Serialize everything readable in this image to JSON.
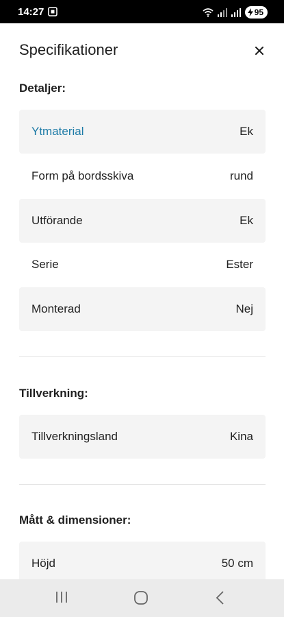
{
  "status_bar": {
    "time": "14:27",
    "battery": "95"
  },
  "header": {
    "title": "Specifikationer"
  },
  "sections": [
    {
      "title": "Detaljer:",
      "rows": [
        {
          "label": "Ytmaterial",
          "value": "Ek"
        },
        {
          "label": "Form på bordsskiva",
          "value": "rund"
        },
        {
          "label": "Utförande",
          "value": "Ek"
        },
        {
          "label": "Serie",
          "value": "Ester"
        },
        {
          "label": "Monterad",
          "value": "Nej"
        }
      ]
    },
    {
      "title": "Tillverkning:",
      "rows": [
        {
          "label": "Tillverkningsland",
          "value": "Kina"
        }
      ]
    },
    {
      "title": "Mått & dimensioner:",
      "rows": [
        {
          "label": "Höjd",
          "value": "50 cm"
        }
      ]
    }
  ],
  "colors": {
    "link": "#1c7aa6",
    "row_shade": "#f4f4f4",
    "nav_bg": "#ebebeb"
  }
}
